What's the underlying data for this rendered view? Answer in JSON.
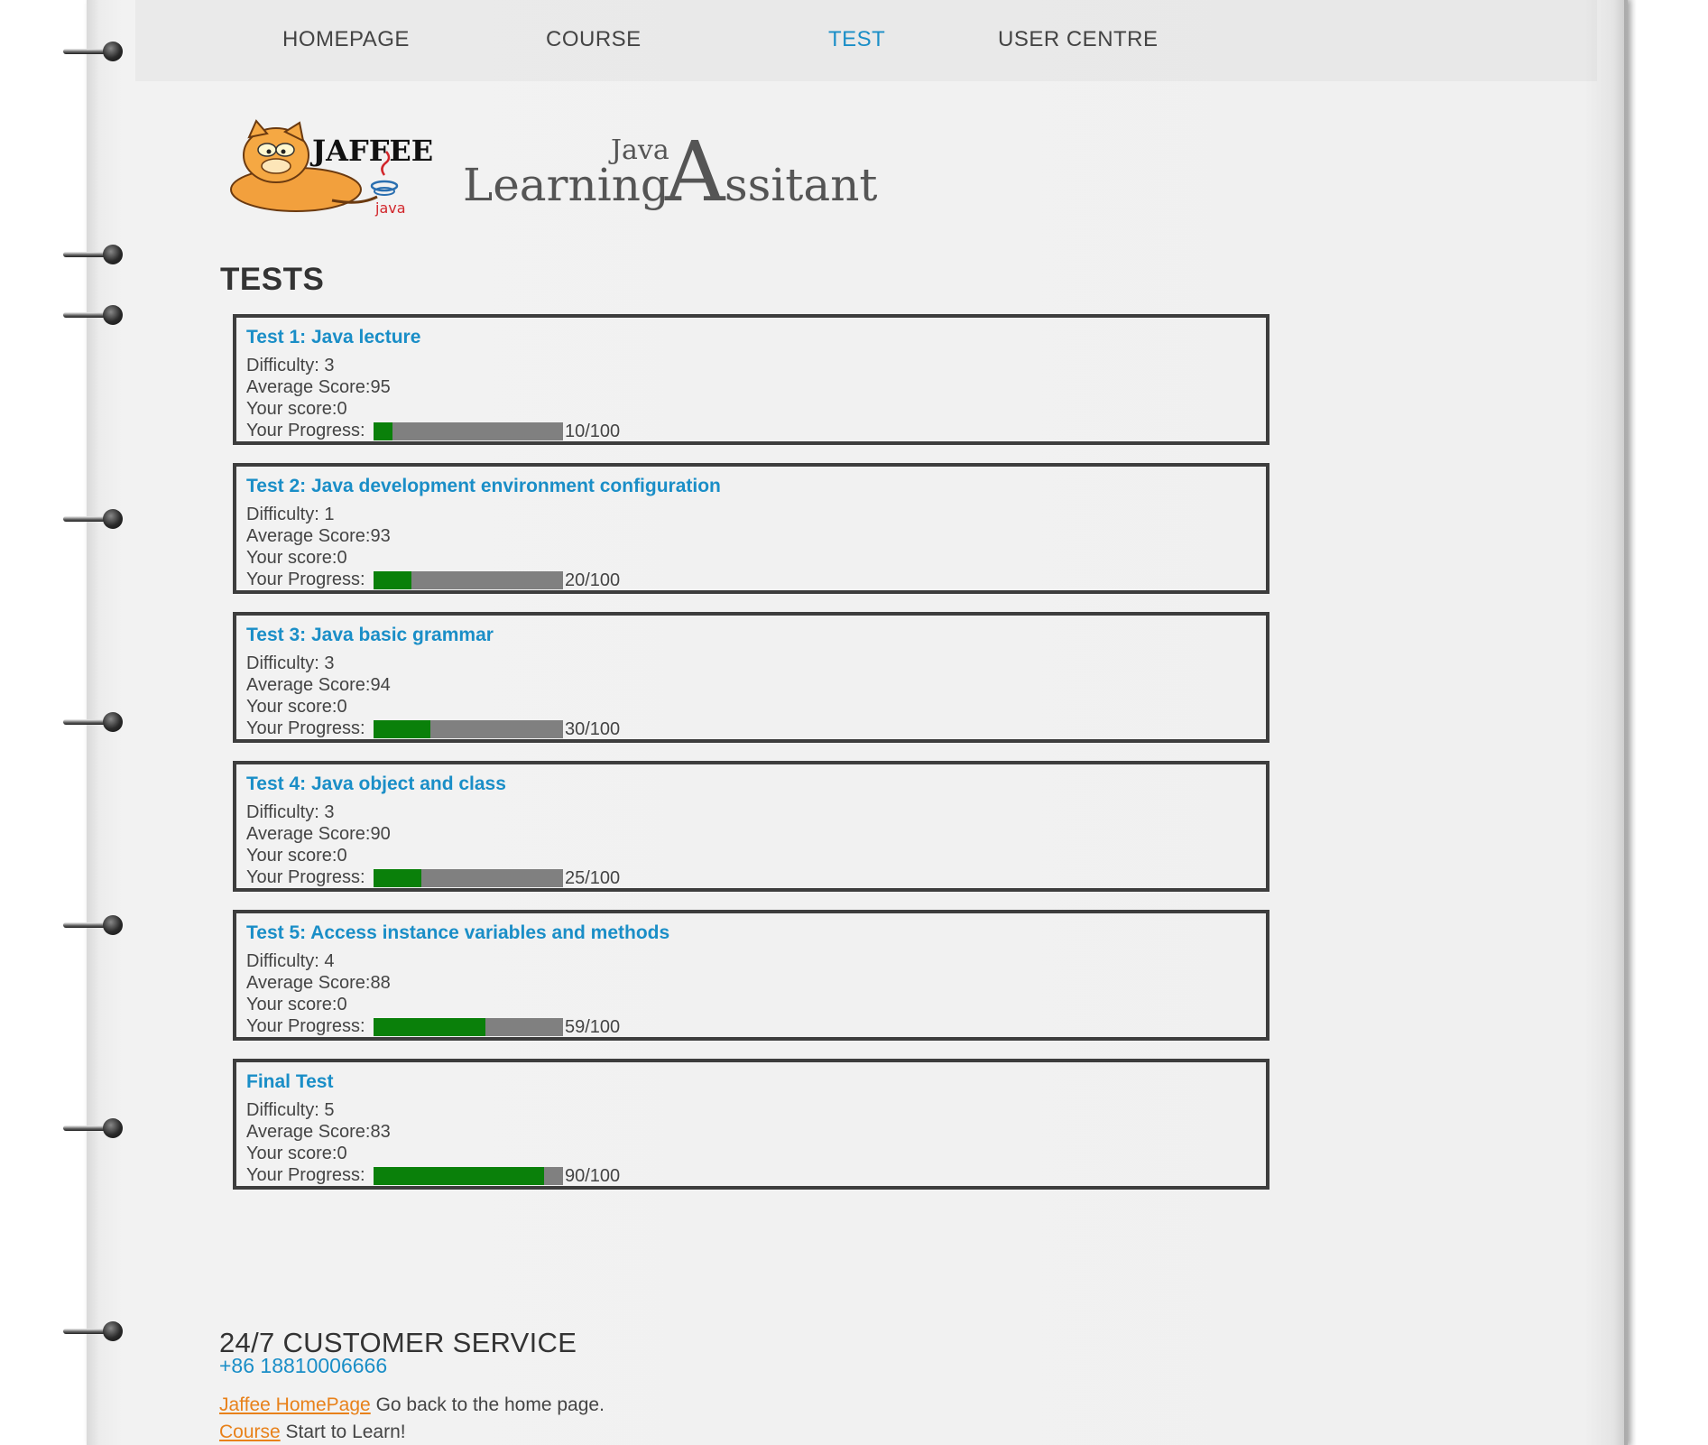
{
  "nav": {
    "items": [
      {
        "label": "HOMEPAGE",
        "active": false
      },
      {
        "label": "COURSE",
        "active": false
      },
      {
        "label": "TEST",
        "active": true
      },
      {
        "label": "USER CENTRE",
        "active": false
      }
    ]
  },
  "logo": {
    "mascot_brand": "JAFFEE",
    "mascot_sub": "java",
    "small_word": "Java",
    "title_word1": "Learning",
    "title_cap": "A",
    "title_rest": "ssitant"
  },
  "page_title": "TESTS",
  "labels": {
    "difficulty": "Difficulty: ",
    "average": "Average Score:",
    "your_score": "Your score:",
    "progress": "Your Progress: "
  },
  "tests": [
    {
      "title": "Test 1: Java lecture",
      "difficulty": "3",
      "average": "95",
      "score": "0",
      "progress": 10,
      "progress_text": "10/100"
    },
    {
      "title": "Test 2: Java development environment configuration",
      "difficulty": "1",
      "average": "93",
      "score": "0",
      "progress": 20,
      "progress_text": "20/100"
    },
    {
      "title": "Test 3: Java basic grammar",
      "difficulty": "3",
      "average": "94",
      "score": "0",
      "progress": 30,
      "progress_text": "30/100"
    },
    {
      "title": "Test 4: Java object and class",
      "difficulty": "3",
      "average": "90",
      "score": "0",
      "progress": 25,
      "progress_text": "25/100"
    },
    {
      "title": "Test 5: Access instance variables and methods",
      "difficulty": "4",
      "average": "88",
      "score": "0",
      "progress": 59,
      "progress_text": "59/100"
    },
    {
      "title": "Final Test",
      "difficulty": "5",
      "average": "83",
      "score": "0",
      "progress": 90,
      "progress_text": "90/100"
    }
  ],
  "footer": {
    "title": "24/7 CUSTOMER SERVICE",
    "phone": "+86 18810006666",
    "links": [
      {
        "link": "Jaffee HomePage",
        "text": " Go back to the home page."
      },
      {
        "link": "Course",
        "text": " Start to Learn!"
      }
    ]
  },
  "colors": {
    "accent": "#1a8ec7",
    "progress_fill": "#0a800a",
    "progress_track": "#808080",
    "footer_link": "#e8811a"
  }
}
